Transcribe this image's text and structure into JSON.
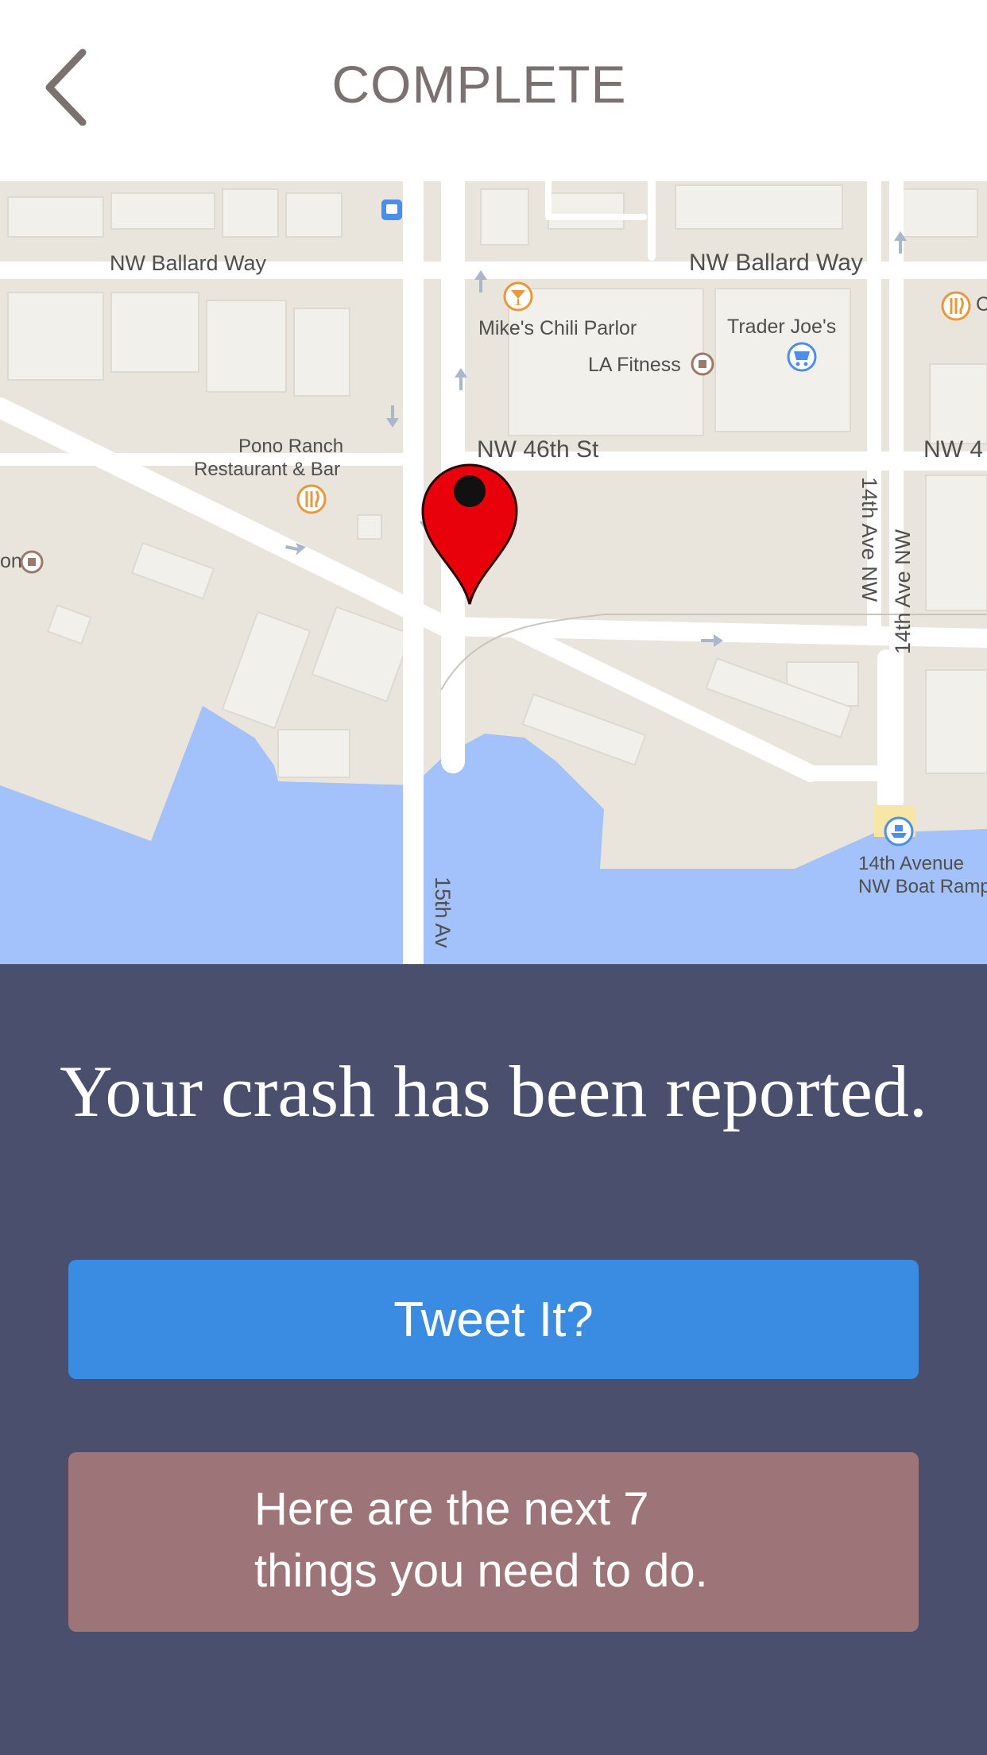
{
  "header": {
    "title": "COMPLETE",
    "back_icon": "chevron-left-icon"
  },
  "map": {
    "streets": {
      "ballard_way_west": "NW Ballard Way",
      "ballard_way_east": "NW Ballard Way",
      "nw_46th": "NW 46th St",
      "nw_4_partial": "NW 4",
      "ave14_a": "14th Ave NW",
      "ave14_b": "14th Ave NW",
      "ave15": "15th Av"
    },
    "places": {
      "mikes": "Mike's Chili Parlor",
      "trader": "Trader Joe's",
      "la_fitness": "LA Fitness",
      "pono_1": "Pono Ranch",
      "pono_2": "Restaurant & Bar",
      "boat_1": "14th Avenue",
      "boat_2": "NW Boat Ramp",
      "edge_left": "on",
      "edge_right": "C"
    },
    "colors": {
      "land": "#e9e5dc",
      "water": "#a3c2fb",
      "road": "#ffffff",
      "pin": "#e8000b"
    }
  },
  "panel": {
    "message": "Your crash has been reported.",
    "tweet_label": "Tweet It?",
    "next_line1": "Here are the next 7",
    "next_line2": "things you need to do."
  },
  "colors": {
    "panel_bg": "#4b4f6e",
    "tweet_bg": "#3a8ce2",
    "next_bg": "#9d7578"
  }
}
